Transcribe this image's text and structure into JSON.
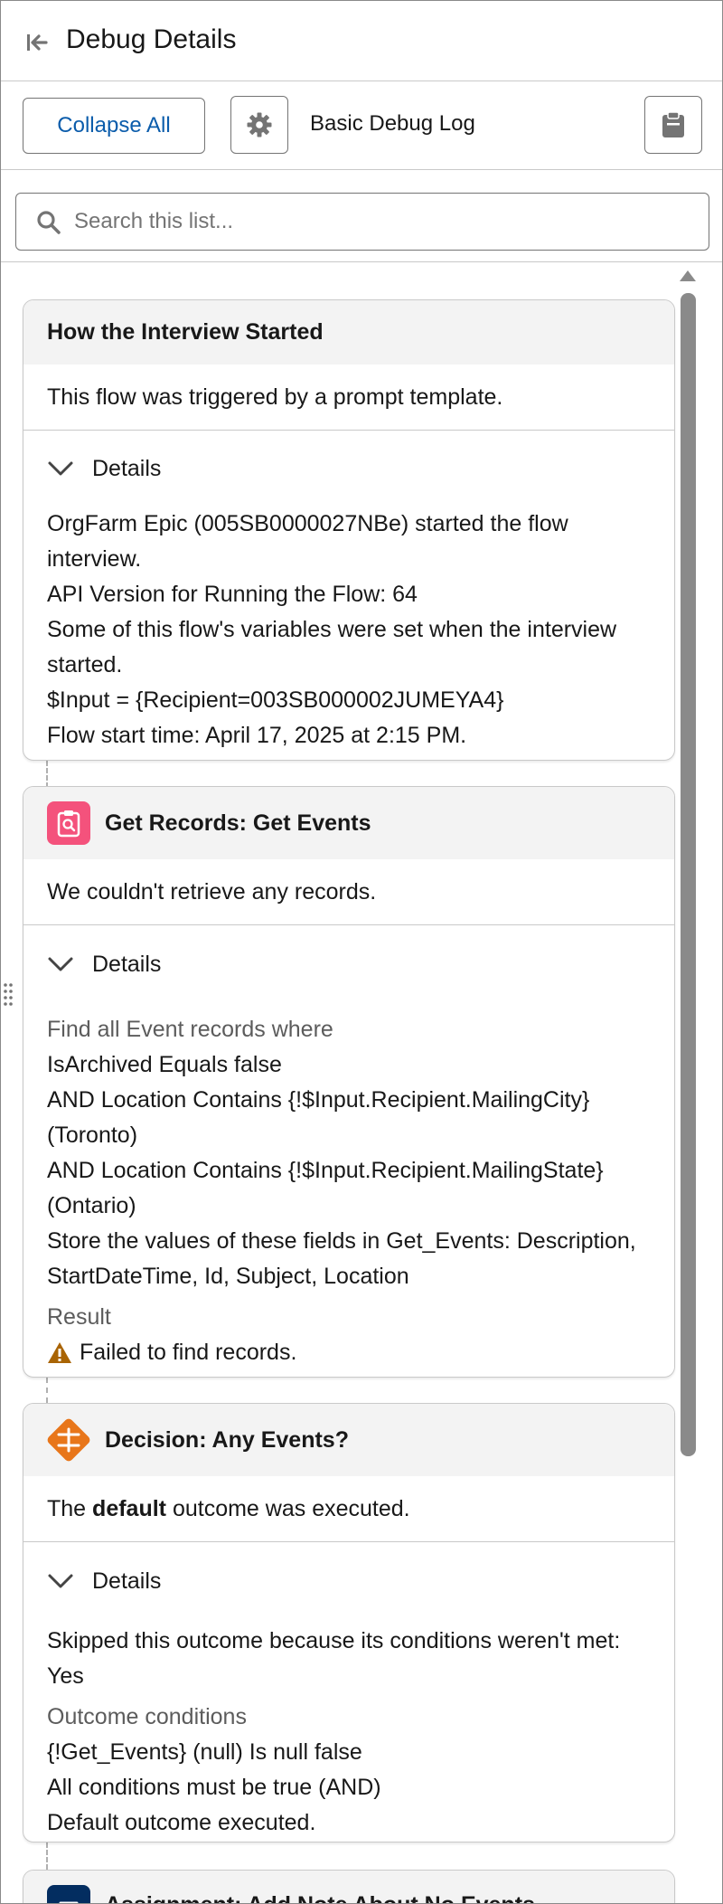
{
  "header": {
    "title": "Debug Details"
  },
  "toolbar": {
    "collapse_label": "Collapse All",
    "log_label": "Basic Debug Log"
  },
  "search": {
    "placeholder": "Search this list..."
  },
  "cards": [
    {
      "title": "How the Interview Started",
      "summary": "This flow was triggered by a prompt template.",
      "details_label": "Details",
      "lines": [
        "OrgFarm Epic (005SB0000027NBe) started the flow",
        "interview.",
        "API Version for Running the Flow: 64",
        "Some of this flow's variables were set when the interview",
        "started.",
        "$Input = {Recipient=003SB000002JUMEYA4}",
        "Flow start time: April 17, 2025 at 2:15 PM."
      ]
    },
    {
      "title": "Get Records: Get Events",
      "icon": "get-records-icon",
      "icon_color": "#f4527c",
      "summary": "We couldn't retrieve any records.",
      "details_label": "Details",
      "criteria_heading": "Find all Event records where",
      "lines": [
        "IsArchived Equals false",
        "AND Location Contains {!$Input.Recipient.MailingCity}",
        "(Toronto)",
        "AND Location Contains {!$Input.Recipient.MailingState}",
        "(Ontario)",
        "Store the values of these fields in Get_Events: Description,",
        "StartDateTime, Id, Subject, Location"
      ],
      "result_heading": "Result",
      "result_text": "Failed to find records."
    },
    {
      "title": "Decision: Any Events?",
      "icon": "decision-icon",
      "icon_color": "#e8761a",
      "summary_prefix": "The",
      "summary_bold": "default",
      "summary_suffix": "outcome was executed.",
      "details_label": "Details",
      "lines_top": [
        "Skipped this outcome because its conditions weren't met:",
        "Yes"
      ],
      "conditions_heading": "Outcome conditions",
      "lines_bottom": [
        "{!Get_Events} (null) Is null false",
        "All conditions must be true (AND)",
        "Default outcome executed."
      ]
    },
    {
      "title": "Assignment: Add Note About No Events",
      "icon": "assignment-icon",
      "icon_color": "#032d60"
    }
  ],
  "colors": {
    "accent": "#0b5cab",
    "warning": "#a96404"
  }
}
